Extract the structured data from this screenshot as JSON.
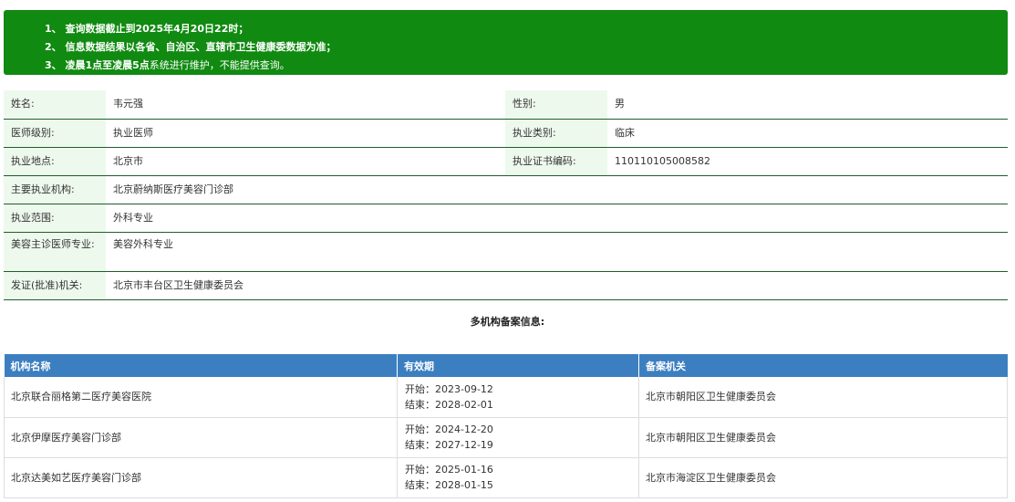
{
  "notice": {
    "line1": "1、 查询数据截止到2025年4月20日22时；",
    "line2": "2、 信息数据结果以各省、自治区、直辖市卫生健康委数据为准；",
    "line3_bold": "3、 凌晨1点至凌晨5点",
    "line3_rest": "系统进行维护，不能提供查询。"
  },
  "info": {
    "name_label": "姓名:",
    "name_value": "韦元强",
    "gender_label": "性别:",
    "gender_value": "男",
    "level_label": "医师级别:",
    "level_value": "执业医师",
    "type_label": "执业类别:",
    "type_value": "临床",
    "place_label": "执业地点:",
    "place_value": "北京市",
    "cert_label": "执业证书编码:",
    "cert_value": "110110105008582",
    "org_label": "主要执业机构:",
    "org_value": "北京蔚纳斯医疗美容门诊部",
    "scope_label": "执业范围:",
    "scope_value": "外科专业",
    "beauty_label": "美容主诊医师专业:",
    "beauty_value": "美容外科专业",
    "issuer_label": "发证(批准)机关:",
    "issuer_value": "北京市丰台区卫生健康委员会"
  },
  "multi_title": "多机构备案信息:",
  "orgs": {
    "headers": [
      "机构名称",
      "有效期",
      "备案机关"
    ],
    "rows": [
      {
        "name": "北京联合丽格第二医疗美容医院",
        "start": "开始：2023-09-12",
        "end": "结束：2028-02-01",
        "authority": "北京市朝阳区卫生健康委员会"
      },
      {
        "name": "北京伊摩医疗美容门诊部",
        "start": "开始：2024-12-20",
        "end": "结束：2027-12-19",
        "authority": "北京市朝阳区卫生健康委员会"
      },
      {
        "name": "北京达美如艺医疗美容门诊部",
        "start": "开始：2025-01-16",
        "end": "结束：2028-01-15",
        "authority": "北京市海淀区卫生健康委员会"
      }
    ]
  }
}
